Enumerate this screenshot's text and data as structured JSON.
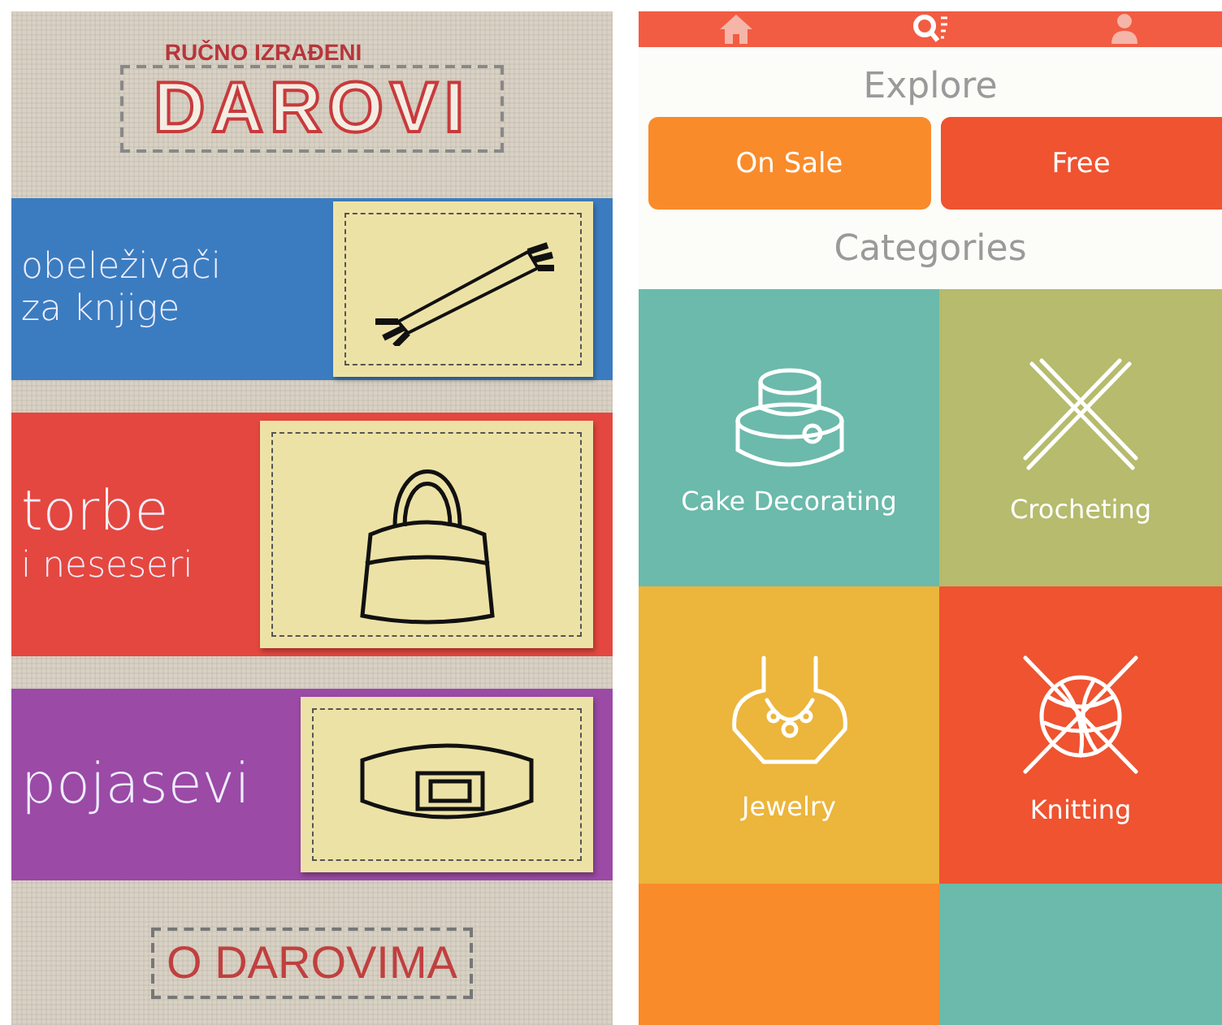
{
  "left_app": {
    "brand_top": "RUČNO IZRAĐENI",
    "brand": "DAROVI",
    "categories": [
      {
        "kind": "scarf",
        "lines": [
          "obeleživači",
          "za knjige"
        ],
        "color": "#3b7cc0"
      },
      {
        "kind": "bag",
        "lines": [
          "torbe",
          "i neseseri"
        ],
        "color": "#e4473f"
      },
      {
        "kind": "belt",
        "lines": [
          "pojasevi"
        ],
        "color": "#9b4aa6"
      }
    ],
    "footer_button": "O DAROVIMA"
  },
  "right_app": {
    "tabs": [
      {
        "kind": "home",
        "selected": false
      },
      {
        "kind": "search",
        "selected": true
      },
      {
        "kind": "profile",
        "selected": false
      }
    ],
    "explore_heading": "Explore",
    "filters": [
      {
        "label": "On Sale",
        "color": "#f98b2a"
      },
      {
        "label": "Free",
        "color": "#ef5330"
      }
    ],
    "categories_heading": "Categories",
    "tiles": [
      {
        "kind": "cake",
        "label": "Cake Decorating",
        "color": "#6bbaab"
      },
      {
        "kind": "hooks",
        "label": "Crocheting",
        "color": "#b6bb6d"
      },
      {
        "kind": "necklace",
        "label": "Jewelry",
        "color": "#ecb53b"
      },
      {
        "kind": "yarn",
        "label": "Knitting",
        "color": "#ef5330"
      },
      {
        "kind": "blank",
        "color": "#f98b2a"
      },
      {
        "kind": "blank",
        "color": "#6bbaab"
      }
    ]
  }
}
